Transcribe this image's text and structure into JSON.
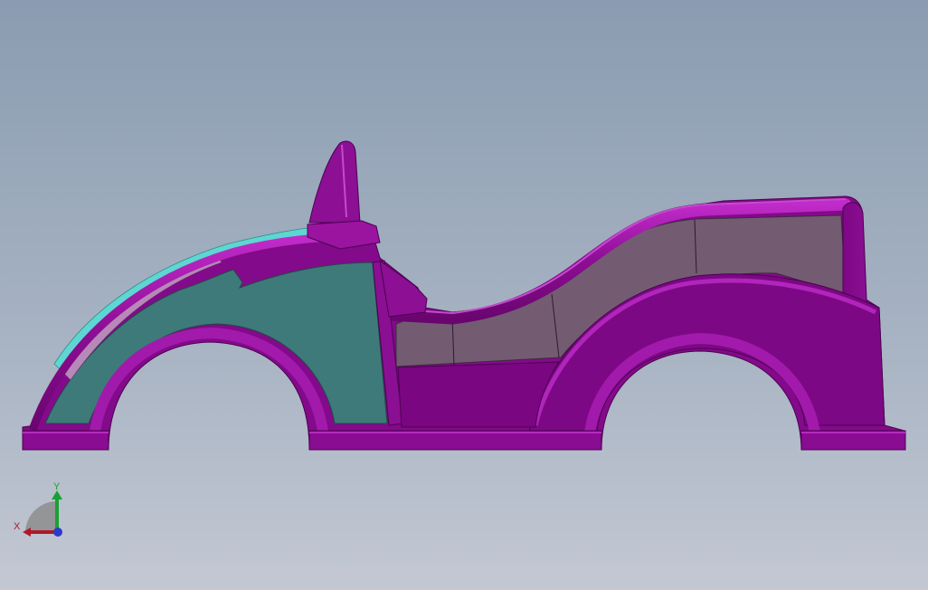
{
  "triad": {
    "x_label": "X",
    "y_label": "Y"
  },
  "colors": {
    "body_magenta": "#850a8c",
    "body_highlight": "#b51fbf",
    "body_shadow": "#5e0366",
    "teal_panel": "#3e7a7a",
    "cyan_edge": "#5ed6d2",
    "window_gray": "#735c72",
    "background_top": "#8a9cb1",
    "background_bottom": "#c3c8d3",
    "axis_x": "#b0182a",
    "axis_y": "#1aa035",
    "axis_z": "#2a3bc8"
  }
}
